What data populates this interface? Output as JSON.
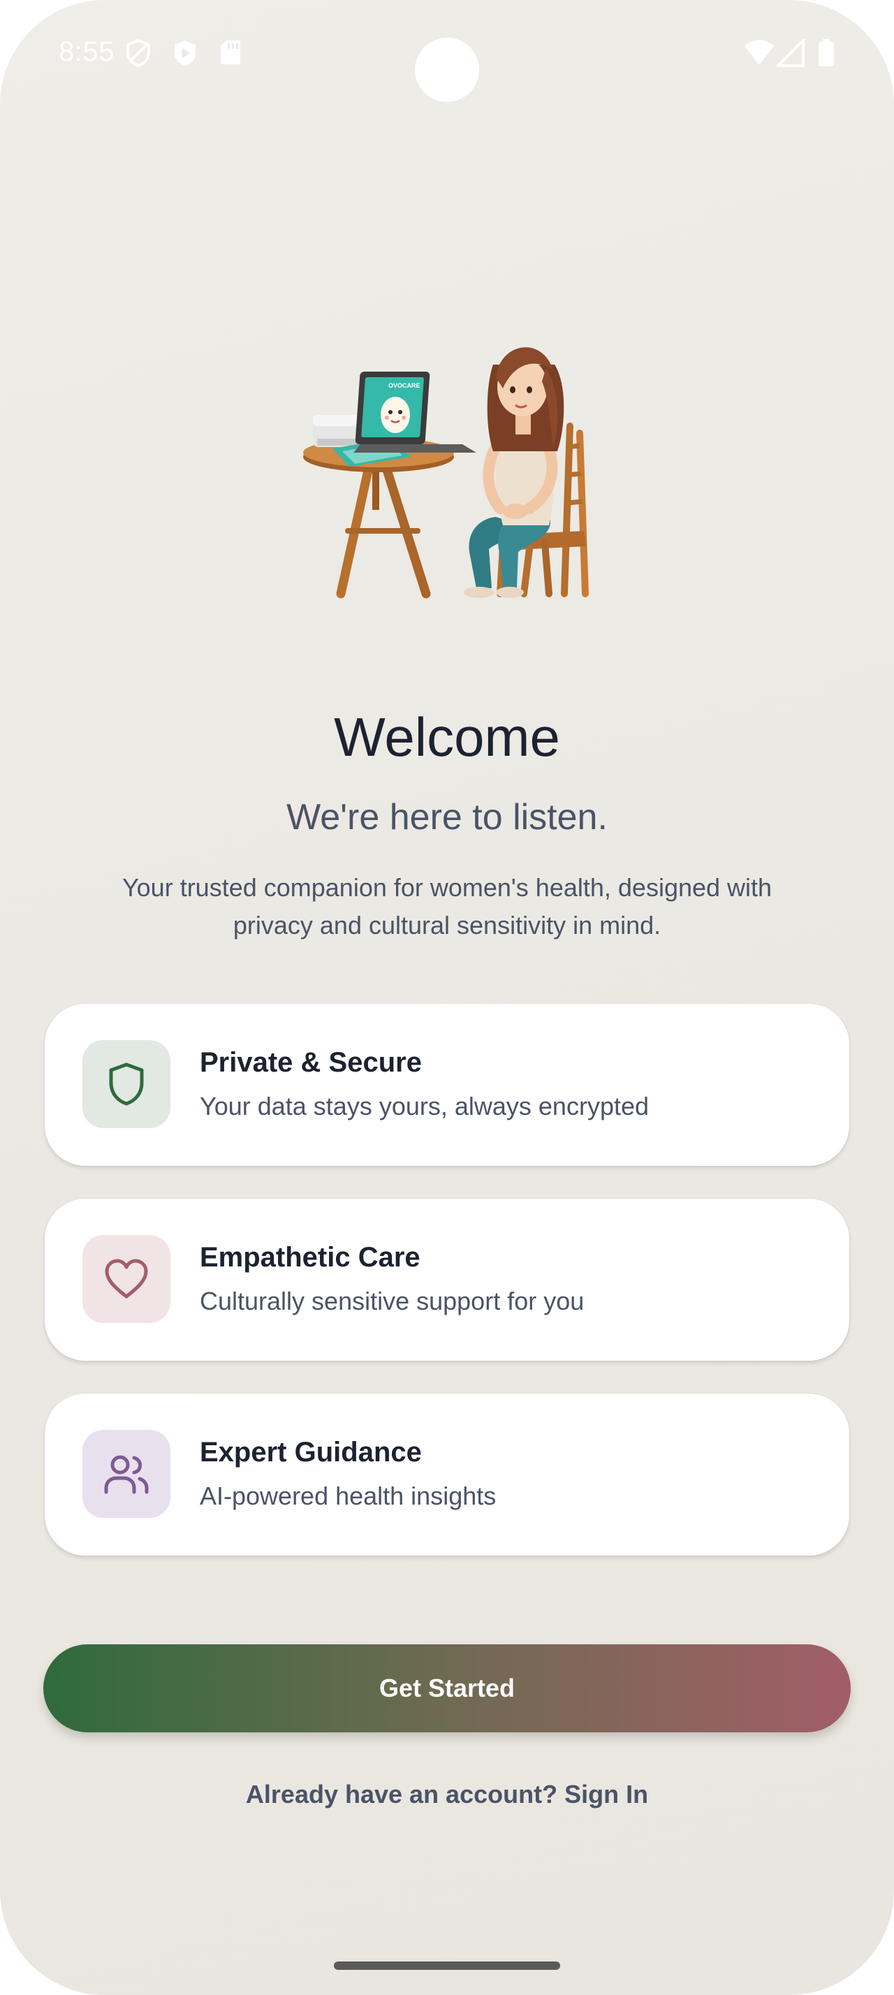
{
  "status_bar": {
    "time": "8:55",
    "left_icons": [
      "shield-status-icon",
      "play-store-icon",
      "sd-card-icon"
    ],
    "right_icons": [
      "wifi-icon",
      "signal-icon",
      "battery-icon"
    ]
  },
  "illustration": {
    "laptop_screen_text": "OVOCARE"
  },
  "welcome": {
    "title": "Welcome",
    "subtitle": "We're here to listen.",
    "description": "Your trusted companion for women's health, designed with privacy and cultural sensitivity in mind."
  },
  "features": [
    {
      "icon": "shield-icon",
      "title": "Private & Secure",
      "subtitle": "Your data stays yours, always encrypted",
      "icon_bg": "#e2e8e2",
      "icon_color": "#2f6b3c"
    },
    {
      "icon": "heart-icon",
      "title": "Empathetic Care",
      "subtitle": "Culturally sensitive support for you",
      "icon_bg": "#f1e4e6",
      "icon_color": "#a25e68"
    },
    {
      "icon": "users-icon",
      "title": "Expert Guidance",
      "subtitle": "AI-powered health insights",
      "icon_bg": "#e9e0ee",
      "icon_color": "#7d5a93"
    }
  ],
  "actions": {
    "get_started_label": "Get Started",
    "sign_in_label": "Already have an account? Sign In"
  },
  "colors": {
    "primary_green": "#2f6b3c",
    "accent_rose": "#a25e68",
    "background": "#edeae4"
  }
}
